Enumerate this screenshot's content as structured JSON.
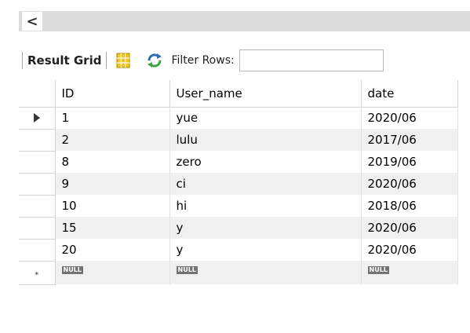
{
  "scroll": {
    "left_arrow_glyph": "<"
  },
  "toolbar": {
    "result_grid_label": "Result Grid",
    "grid_icon": "grid-layout-icon",
    "refresh_icon": "refresh-icon",
    "filter_label": "Filter Rows:",
    "filter_value": ""
  },
  "grid": {
    "columns": [
      "ID",
      "User_name",
      "date"
    ],
    "rows": [
      {
        "id": "1",
        "user_name": "yue",
        "date": "2020/06"
      },
      {
        "id": "2",
        "user_name": "lulu",
        "date": "2017/06"
      },
      {
        "id": "8",
        "user_name": "zero",
        "date": "2019/06"
      },
      {
        "id": "9",
        "user_name": "ci",
        "date": "2020/06"
      },
      {
        "id": "10",
        "user_name": "hi",
        "date": "2018/06"
      },
      {
        "id": "15",
        "user_name": "y",
        "date": "2020/06"
      },
      {
        "id": "20",
        "user_name": "y",
        "date": "2020/06"
      }
    ],
    "null_label": "NULL",
    "new_row_marker": "*"
  },
  "colors": {
    "alt_row": "#f0f0f0",
    "null_badge": "#737373",
    "refresh_blue": "#2a6fb5",
    "refresh_green": "#3ea33e",
    "grid_icon_yellow": "#f5c518"
  }
}
